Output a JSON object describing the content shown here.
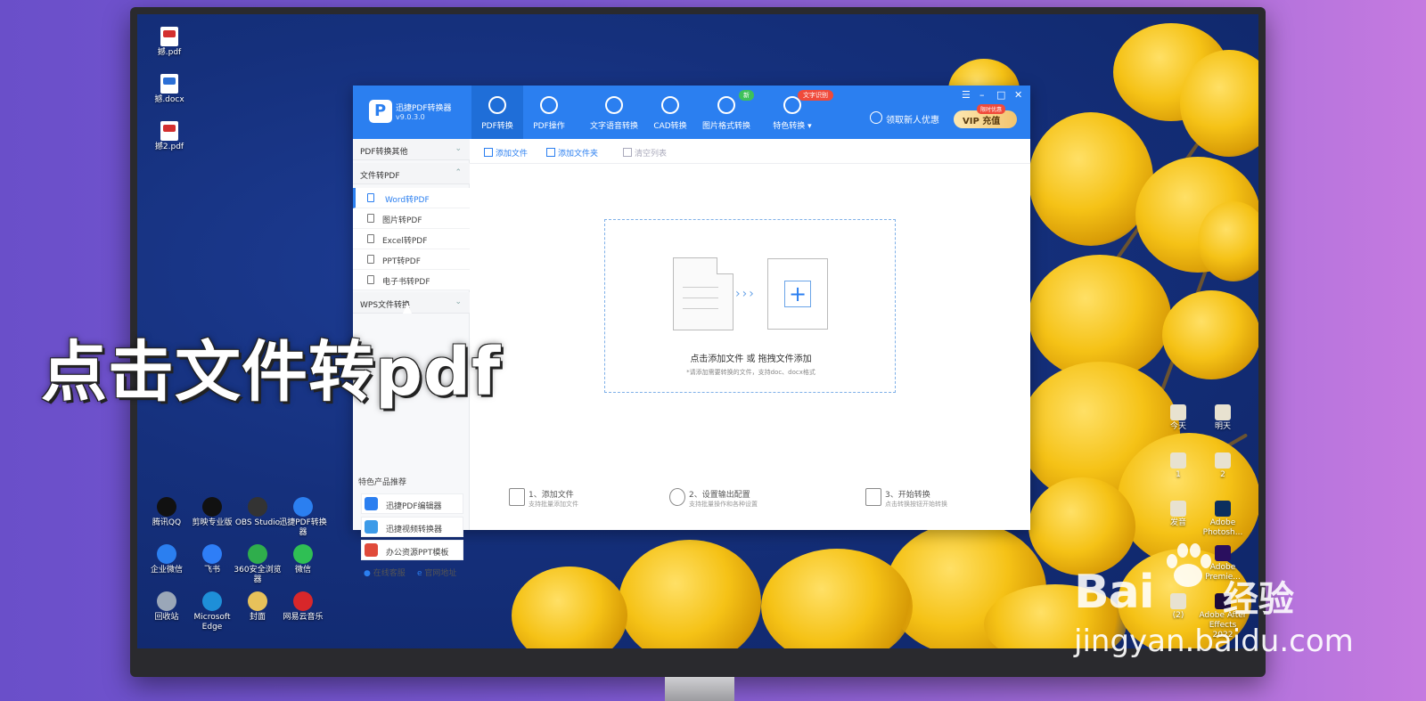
{
  "caption": "点击文件转pdf",
  "watermark": {
    "brand": "Bai",
    "brand_suffix": "经验",
    "url": "jingyan.baidu.com"
  },
  "desktop_left_files": [
    {
      "label": "撼.pdf",
      "color": "#d32f2f"
    },
    {
      "label": "撼.docx",
      "color": "#2b6fd6"
    },
    {
      "label": "撼2.pdf",
      "color": "#d32f2f"
    }
  ],
  "desktop_taskbar_icons": [
    {
      "label": "腾讯QQ",
      "icon": "qq-icon",
      "color": "#111"
    },
    {
      "label": "剪映专业版",
      "icon": "capcut-icon",
      "color": "#111"
    },
    {
      "label": "OBS Studio",
      "icon": "obs-icon",
      "color": "#333"
    },
    {
      "label": "迅捷PDF转换器",
      "icon": "pdf-converter-icon",
      "color": "#2b7ff0"
    },
    {
      "label": "企业微信",
      "icon": "wecom-icon",
      "color": "#2b7ff0"
    },
    {
      "label": "飞书",
      "icon": "feishu-icon",
      "color": "#2e7ef7"
    },
    {
      "label": "360安全浏览器",
      "icon": "browser-360-icon",
      "color": "#2fae4c"
    },
    {
      "label": "微信",
      "icon": "wechat-icon",
      "color": "#2fbf54"
    },
    {
      "label": "回收站",
      "icon": "recycle-bin-icon",
      "color": "#9aa7b8"
    },
    {
      "label": "Microsoft Edge",
      "icon": "edge-icon",
      "color": "#1e8fd8"
    },
    {
      "label": "封面",
      "icon": "file-icon",
      "color": "#e7c15a"
    },
    {
      "label": "网易云音乐",
      "icon": "netease-music-icon",
      "color": "#d8272a"
    }
  ],
  "desktop_right_icons": [
    {
      "label": "今天"
    },
    {
      "label": "明天"
    },
    {
      "label": "1"
    },
    {
      "label": "2"
    },
    {
      "label": "发音"
    },
    {
      "label": "Adobe Photosh..."
    },
    {
      "label": "Adobe Premie..."
    },
    {
      "label": "(2)"
    },
    {
      "label": "Adobe After Effects 2022"
    }
  ],
  "app": {
    "name": "迅捷PDF转换器",
    "version": "v9.0.3.0",
    "tabs": [
      {
        "label": "PDF转换",
        "icon": "pdf-convert-icon"
      },
      {
        "label": "PDF操作",
        "icon": "pdf-operate-icon"
      },
      {
        "label": "文字语音转换",
        "icon": "voice-icon"
      },
      {
        "label": "CAD转换",
        "icon": "cad-icon"
      },
      {
        "label": "图片格式转换",
        "icon": "image-icon"
      },
      {
        "label": "特色转换",
        "icon": "special-icon"
      }
    ],
    "badge_new": "新",
    "badge_ocr": "文字识别",
    "promo": "领取新人优惠",
    "vip_label": "VIP 充值",
    "vip_badge": "限时优惠",
    "window_controls": [
      "☰",
      "–",
      "□",
      "✕"
    ],
    "sidebar": {
      "group1": "PDF转换其他",
      "group2": "文件转PDF",
      "items": [
        "Word转PDF",
        "图片转PDF",
        "Excel转PDF",
        "PPT转PDF",
        "电子书转PDF"
      ],
      "group3": "WPS文件转换",
      "featured_title": "特色产品推荐",
      "featured": [
        {
          "label": "迅捷PDF编辑器",
          "color": "#2b7ff0"
        },
        {
          "label": "迅捷视频转换器",
          "color": "#3d9be8"
        },
        {
          "label": "办公资源PPT模板",
          "color": "#e04a3a"
        }
      ],
      "footer_service": "在线客服",
      "footer_site": "官网地址"
    },
    "toolbar": {
      "add_file": "添加文件",
      "add_folder": "添加文件夹",
      "clear": "清空列表"
    },
    "dropzone": {
      "main": "点击添加文件 或 拖拽文件添加",
      "sub": "*请添加需要转换的文件，支持doc、docx格式"
    },
    "steps": [
      {
        "title": "1、添加文件",
        "sub": "支持批量添加文件"
      },
      {
        "title": "2、设置输出配置",
        "sub": "支持批量操作和各种设置"
      },
      {
        "title": "3、开始转换",
        "sub": "点击转换按钮开始转换"
      }
    ]
  }
}
